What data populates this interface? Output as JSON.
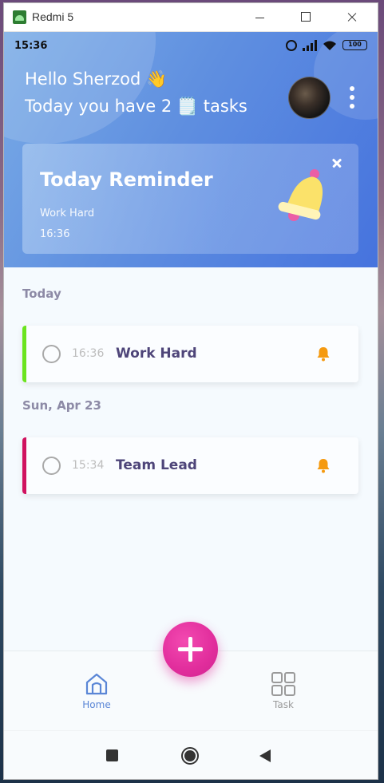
{
  "window": {
    "title": "Redmi 5"
  },
  "status_bar": {
    "time": "15:36",
    "battery": "100"
  },
  "header": {
    "greeting_line1": "Hello Sherzod 👋",
    "greeting_line2": "Today you have 2 🗒️ tasks"
  },
  "reminder": {
    "title": "Today Reminder",
    "task": "Work Hard",
    "time": "16:36"
  },
  "sections": [
    {
      "title": "Today",
      "tasks": [
        {
          "time": "16:36",
          "name": "Work Hard",
          "color": "#6be41e"
        }
      ]
    },
    {
      "title": "Sun, Apr 23",
      "tasks": [
        {
          "time": "15:34",
          "name": "Team Lead",
          "color": "#d0125f"
        }
      ]
    }
  ],
  "bottom_nav": {
    "home_label": "Home",
    "task_label": "Task"
  },
  "colors": {
    "header_start": "#79abe6",
    "header_end": "#4673de",
    "accent_fab": "#e12d9c",
    "task_title": "#4e4579",
    "bell_orange": "#f59a10",
    "nav_active": "#5a86d6"
  }
}
